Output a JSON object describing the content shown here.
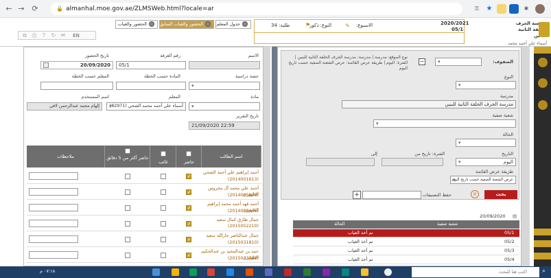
{
  "browser": {
    "url": "almanhal.moe.gov.ae/ZLMSWeb.html?locale=ar",
    "back_icon": "arrow-left-icon",
    "forward_icon": "arrow-right-icon",
    "reload_icon": "reload-icon"
  },
  "header": {
    "tabs": [
      {
        "label": "جدول المعلم"
      },
      {
        "label": "الحضور والغياب السابق"
      },
      {
        "label": "الحضور والغياب"
      }
    ],
    "toolbar_lang": "EN",
    "week_label": "الاسبوع:",
    "gender": "النوع: ذكور",
    "students_label": "طلبة: 34",
    "year": "2020/2021",
    "section": "05/1",
    "school_name": "مدرسة الجرف الحلقة الثانية للبنين",
    "teacher_name": "أسماء علي أحمد محمد الشحي"
  },
  "left": {
    "labels": {
      "name": "الاسم",
      "room": "رقم الغرفة",
      "attendance_date": "تاريخ الحضور",
      "period": "حصة دراسية",
      "subject_plan": "المادة حسب الخطة",
      "teacher_plan": "المعلم حسب الخطة",
      "subject": "مادة",
      "teacher": "المعلم",
      "username": "اسم المستخدم",
      "report_date": "تاريخ التقرير"
    },
    "values": {
      "room": "05/1",
      "attendance_date": "20/09/2020",
      "teacher": "أسماء علي أحمد محمد الشحي (82971)",
      "username": "إلهام محمد عبدالرحمن لافي",
      "report_date": "21/09/2020 22:59"
    },
    "grid": {
      "headers": {
        "student": "اسم الطالب",
        "present": "حاضر",
        "absent": "غائب",
        "late": "حاضر أكثر من 5 دقائق",
        "notes": "ملاحظات"
      },
      "rows": [
        {
          "name": "أحمد إبراهيم علي أحمد الشحي",
          "id": "(2014001613)",
          "present": true
        },
        {
          "name": "أحمد علي محمد آل محروس الظهوري",
          "id": "(2014005873)",
          "present": true
        },
        {
          "name": "أحمد فهد أحمد محمد إبراهيم الظهوري",
          "id": "(2014058445)",
          "present": true
        },
        {
          "name": "جمال طارق كمال سعيد (2015052210)",
          "id": "",
          "present": true
        },
        {
          "name": "جمال عبدالناصر جارالله سعيد",
          "id": "(2015031810)",
          "present": true
        },
        {
          "name": "حمد بن عبدالمجيد بن عبدالحكيم الظهوري",
          "id": "(2015033712)",
          "present": true
        }
      ]
    }
  },
  "right": {
    "filters": {
      "sections_label": "الصفوف:",
      "type_label": "النوع",
      "school_label": "مدرسة",
      "school_value": "مدرسة الجرف الحلقة الثانية للبنين",
      "class_section_label": "شعبة صفية",
      "status_label": "الحالة",
      "date_label": "التاريخ",
      "date_value": "اليوم",
      "period_from_label": "الفترة: تاريخ من",
      "to_label": "إلى",
      "view_method_label": "طريقة عرض القائمة",
      "view_method_value": "عرض الشعبة الصفية حسب تاريخ اليوم",
      "save_classifications": "حفظ التصنيفات",
      "search_button": "بحث",
      "breadcrumb": "نوع الموقع: مدرسة | مدرسة: مدرسة الجرف الحلقة الثانية للبنين | الفترة: اليوم | طريقة عرض القائمة: عرض الشعبة الصفية حسب تاريخ اليوم"
    },
    "results": {
      "date": "20/09/2020",
      "headers": {
        "section": "شعبة صفية",
        "status": "الحالة"
      },
      "rows": [
        {
          "section": "05/1",
          "status": "تم أخذ الغياب",
          "selected": true
        },
        {
          "section": "05/2",
          "status": "تم أخذ الغياب",
          "selected": false
        },
        {
          "section": "05/3",
          "status": "تم أخذ الغياب",
          "selected": false
        },
        {
          "section": "05/4",
          "status": "تم أخذ الغياب",
          "selected": false
        }
      ]
    }
  },
  "taskbar": {
    "clock": "٠٧:١٨ م",
    "search_placeholder": "اكتب هنا للبحث"
  },
  "colors": {
    "header_accent": "#d8b04a",
    "grid_header": "#6e6e6e",
    "selected_row": "#b71c1c",
    "search_button": "#b71c1c",
    "check_on": "#c9a227",
    "taskbar": "#1f3f66"
  }
}
